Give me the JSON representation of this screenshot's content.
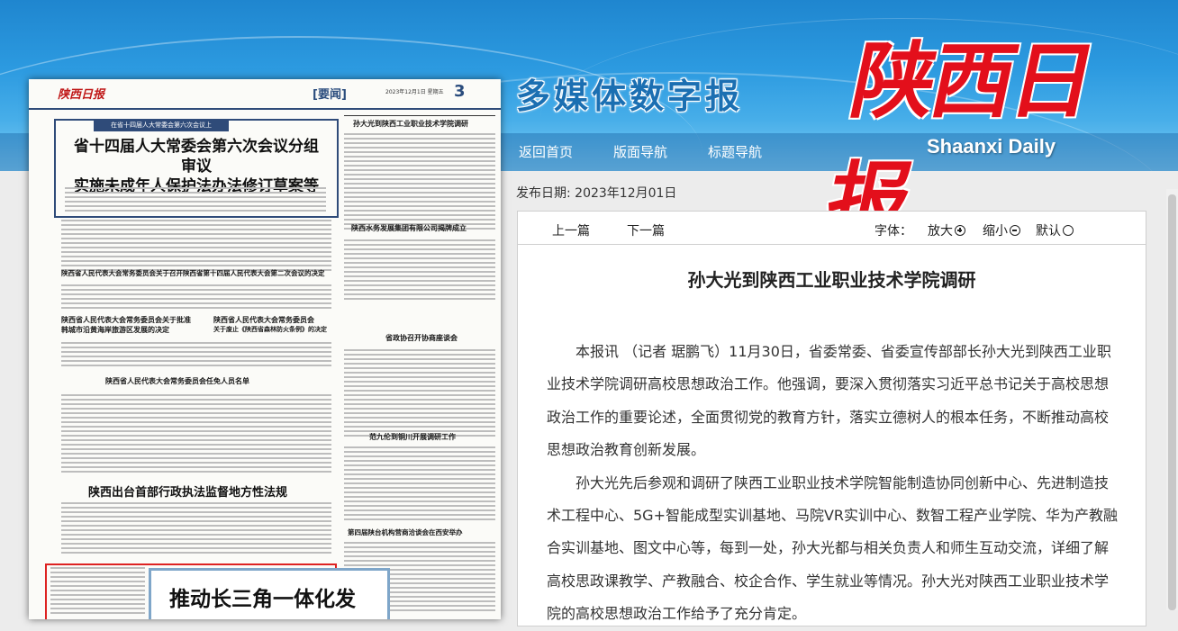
{
  "header": {
    "brand_title": "多媒体数字报",
    "logo_cn": "陕西日报",
    "logo_en": "Shaanxi Daily",
    "nav": [
      "返回首页",
      "版面导航",
      "标题导航"
    ]
  },
  "newspaper": {
    "logo": "陕西日报",
    "section": "[要闻]",
    "date": "2023年12月1日 星期五",
    "page_number": "3",
    "box_tag": "在省十四届人大常委会第六次会议上",
    "headline1_line1": "省十四届人大常委会第六次会议分组审议",
    "headline1_line2": "实施未成年人保护法办法修订草案等",
    "right_col_title": "孙大光到陕西工业职业技术学院调研",
    "sub1": "陕西省人民代表大会常务委员会关于召开陕西省第十四届人民代表大会第二次会议的决定",
    "sub2a": "陕西省人民代表大会常务委员会关于批准",
    "sub2b": "韩城市沿黄海岸旅游区发展的决定",
    "sub3a": "陕西省人民代表大会常务委员会",
    "sub3b": "关于废止《陕西省森林防火条例》的决定",
    "sub4": "陕西省人民代表大会常务委员会任免人员名单",
    "sub5": "陕西水务发展集团有限公司揭牌成立",
    "sub6": "省政协召开协商座谈会",
    "sub7": "范九伦到铜川开展调研工作",
    "sub8": "第四届陕台机构营商洽谈会在西安举办",
    "headline2": "陕西出台首部行政执法监督地方性法规",
    "headline3": "推动长三角一体化发"
  },
  "article": {
    "pubdate_label": "发布日期:",
    "pubdate_value": "2023年12月01日",
    "prev": "上一篇",
    "next": "下一篇",
    "font_label": "字体：",
    "zoom_in": "放大",
    "zoom_out": "缩小",
    "zoom_default": "默认",
    "title": "孙大光到陕西工业职业技术学院调研",
    "paragraph1": "本报讯 （记者 琚鹏飞）11月30日，省委常委、省委宣传部部长孙大光到陕西工业职业技术学院调研高校思想政治工作。他强调，要深入贯彻落实习近平总书记关于高校思想政治工作的重要论述，全面贯彻党的教育方针，落实立德树人的根本任务，不断推动高校思想政治教育创新发展。",
    "paragraph2": "孙大光先后参观和调研了陕西工业职业技术学院智能制造协同创新中心、先进制造技术工程中心、5G+智能成型实训基地、马院VR实训中心、数智工程产业学院、华为产教融合实训基地、图文中心等，每到一处，孙大光都与相关负责人和师生互动交流，详细了解高校思政课教学、产教融合、校企合作、学生就业等情况。孙大光对陕西工业职业技术学院的高校思想政治工作给予了充分肯定。"
  }
}
